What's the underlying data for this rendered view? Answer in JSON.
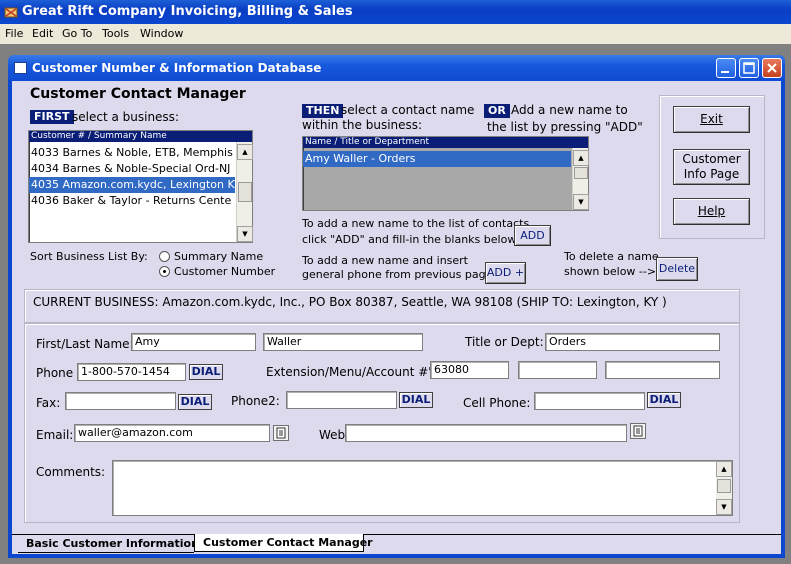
{
  "app": {
    "title": "Great Rift Company Invoicing, Billing & Sales"
  },
  "menu": [
    "File",
    "Edit",
    "Go To",
    "Tools",
    "Window"
  ],
  "window": {
    "title": "Customer Number & Information Database"
  },
  "header": {
    "title": "Customer Contact Manager"
  },
  "business": {
    "first_tag": "FIRST",
    "first_text": "select a business:",
    "list_header": "Customer #  /  Summary Name",
    "items": [
      "4033  Barnes & Noble, ETB, Memphis",
      "4034  Barnes & Noble-Special Ord-NJ",
      "4035  Amazon.com.kydc, Lexington KY",
      "4036  Baker & Taylor - Returns Cente"
    ],
    "selected_index": 2
  },
  "contact": {
    "then_tag": "THEN",
    "then_text_1": "select a contact name",
    "then_text_2": "within the business:",
    "or_tag": "OR",
    "or_text_1": "Add a new name to",
    "or_text_2": "the list by pressing \"ADD\"",
    "list_header": "Name  /  Title or Department",
    "items": [
      "Amy Waller - Orders"
    ]
  },
  "side_buttons": {
    "exit": "Exit",
    "customer_info_1": "Customer",
    "customer_info_2": "Info Page",
    "help": "Help"
  },
  "sort": {
    "label": "Sort Business List By:",
    "options": [
      "Summary Name",
      "Customer Number"
    ],
    "selected": "Customer Number"
  },
  "actions": {
    "add_text_1": "To add a new name to the list of contacts,",
    "add_text_2": "click \"ADD\" and fill-in the blanks below -->",
    "add_button": "ADD",
    "addplus_text_1": "To add a new name and insert",
    "addplus_text_2": "general phone from previous page->",
    "addplus_button": "ADD +",
    "delete_text_1": "To delete a name",
    "delete_text_2": "shown below -->",
    "delete_button": "Delete"
  },
  "current_business": "CURRENT BUSINESS: Amazon.com.kydc, Inc., PO Box 80387, Seattle, WA  98108  (SHIP TO: Lexington, KY )",
  "form": {
    "name_label": "First/Last Name:",
    "first_name": "Amy",
    "last_name": "Waller",
    "title_label": "Title or Dept:",
    "title_value": "Orders",
    "phone_label": "Phone",
    "phone_value": "1-800-570-1454",
    "dial_label": "DIAL",
    "ext_label": "Extension/Menu/Account #'s:",
    "ext_values": [
      "63080",
      "",
      ""
    ],
    "fax_label": "Fax:",
    "fax_value": "",
    "phone2_label": "Phone2:",
    "phone2_value": "",
    "cell_label": "Cell Phone:",
    "cell_value": "",
    "email_label": "Email:",
    "email_value": "waller@amazon.com",
    "website_label": "Website:",
    "website_value": "",
    "comments_label": "Comments:",
    "comments_value": ""
  },
  "tabs": [
    "Basic Customer Information",
    "Customer Contact Manager"
  ],
  "colors": {
    "title_blue": "#0b47cf",
    "client_bg": "#dcdaec",
    "tag_navy": "#0a1e78",
    "selection": "#316ac5"
  }
}
